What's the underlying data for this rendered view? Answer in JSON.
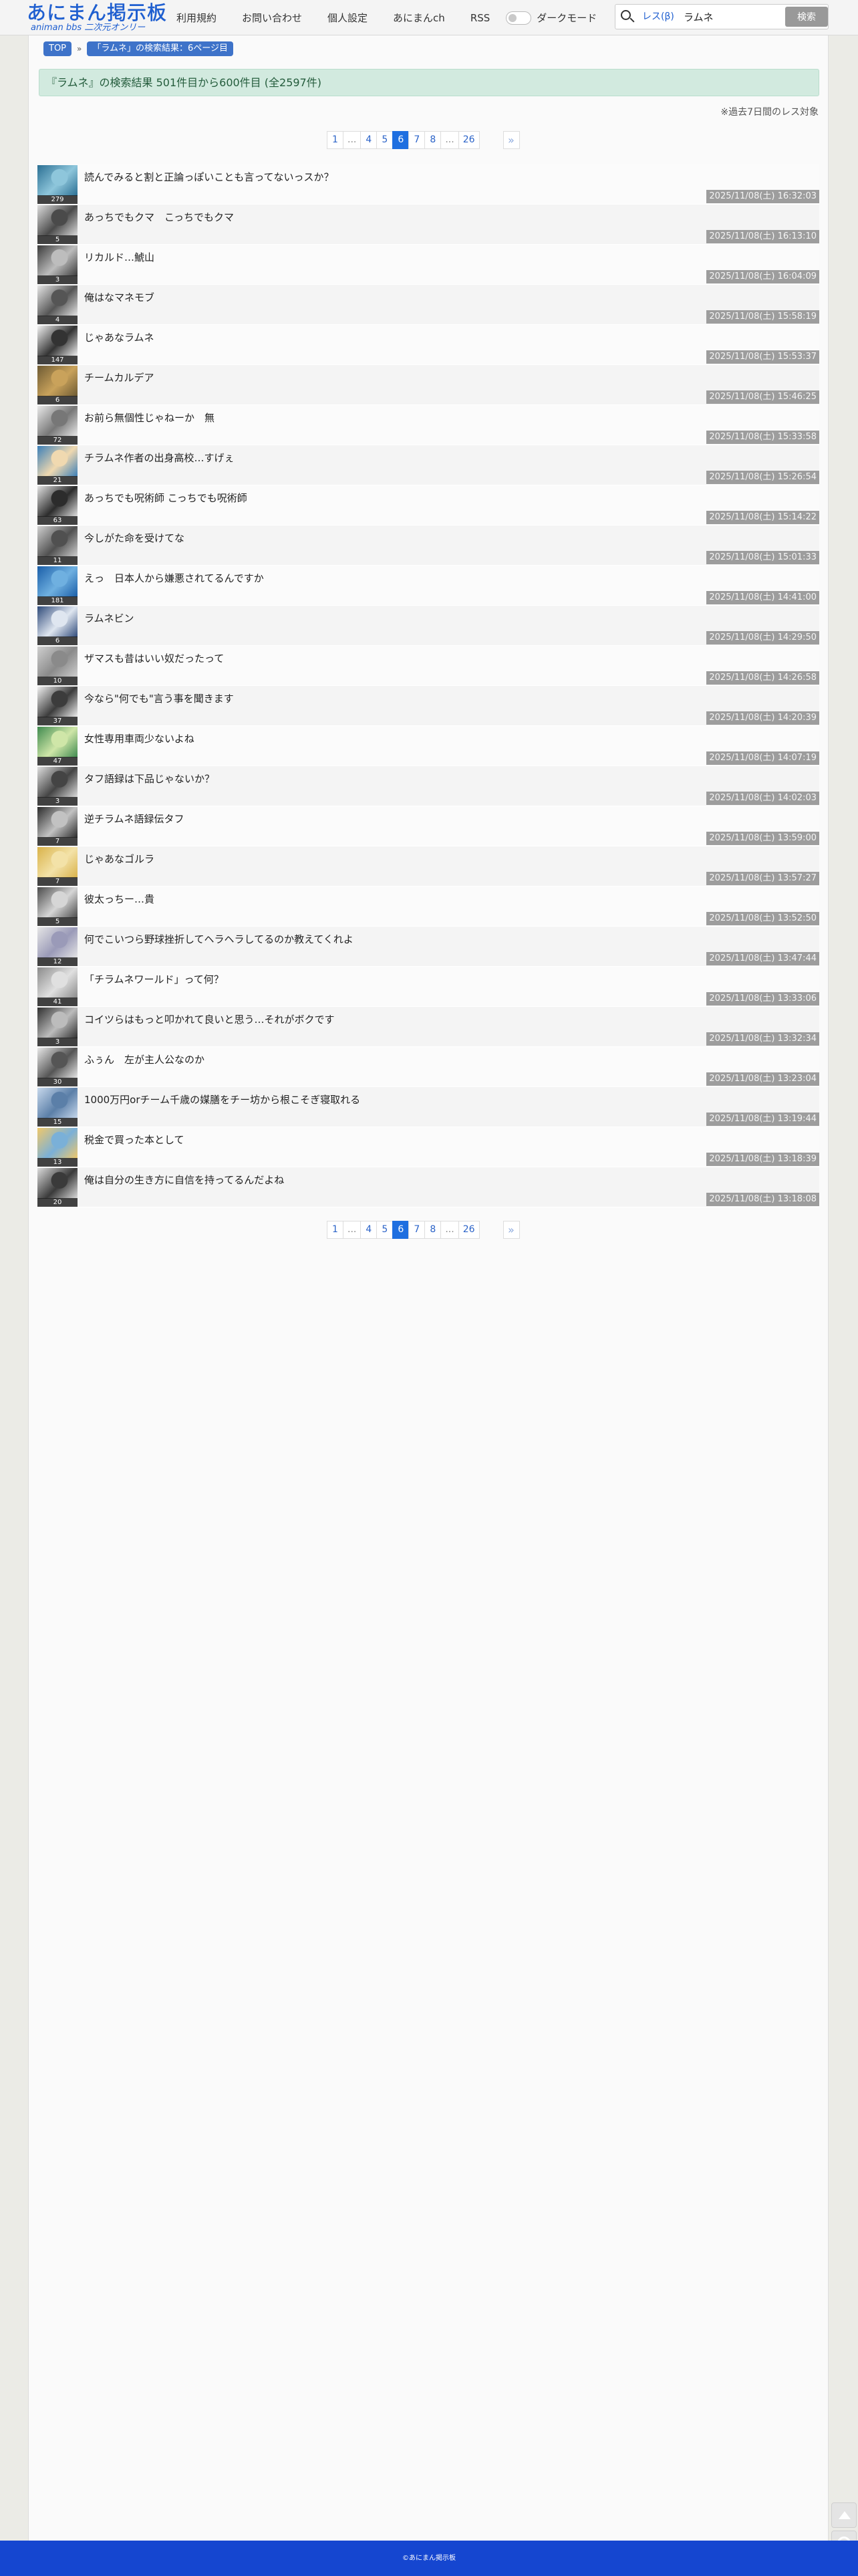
{
  "header": {
    "logo_main": "あにまん掲示板",
    "logo_sub": "animan bbs 二次元オンリー",
    "nav": [
      "利用規約",
      "お問い合わせ",
      "個人設定",
      "あにまんch",
      "RSS"
    ],
    "dark_mode_label": "ダークモード",
    "search_type": "レス(β)",
    "search_value": "ラムネ",
    "search_button": "検索"
  },
  "breadcrumb": [
    "TOP",
    "「ラムネ」の検索結果：6ページ目"
  ],
  "breadcrumb_sep": "»",
  "result_banner": "『ラムネ』の検索結果 501件目から600件目 (全2597件)",
  "note": "※過去7日間のレス対象",
  "pagination": [
    "«",
    "1",
    "...",
    "4",
    "5",
    "6",
    "7",
    "8",
    "...",
    "26",
    "»"
  ],
  "pagination_active": "6",
  "threads": [
    {
      "title": "読んでみると割と正論っぽいことも言ってないっスか？",
      "count": "279",
      "date": "2025/11/08(土) 16:32:03",
      "colors": [
        "#2b6f93",
        "#8ec6db"
      ]
    },
    {
      "title": "あっちでもクマ　こっちでもクマ",
      "count": "5",
      "date": "2025/11/08(土) 16:13:10",
      "colors": [
        "#dcdcdc",
        "#4a4a4a"
      ]
    },
    {
      "title": "リカルド…鯱山",
      "count": "3",
      "date": "2025/11/08(土) 16:04:09",
      "colors": [
        "#3a3a3a",
        "#bdbdbd"
      ]
    },
    {
      "title": "俺はなマネモブ",
      "count": "4",
      "date": "2025/11/08(土) 15:58:19",
      "colors": [
        "#e6e6e6",
        "#555555"
      ]
    },
    {
      "title": "じゃあなラムネ",
      "count": "147",
      "date": "2025/11/08(土) 15:53:37",
      "colors": [
        "#f2f2f2",
        "#333333"
      ]
    },
    {
      "title": "チームカルデア",
      "count": "6",
      "date": "2025/11/08(土) 15:46:25",
      "colors": [
        "#6d5a33",
        "#c9a25b"
      ]
    },
    {
      "title": "お前ら無個性じゃねーか　無",
      "count": "72",
      "date": "2025/11/08(土) 15:33:58",
      "colors": [
        "#e9e9e9",
        "#777777"
      ]
    },
    {
      "title": "チラムネ作者の出身高校…すげぇ",
      "count": "21",
      "date": "2025/11/08(土) 15:26:54",
      "colors": [
        "#3b7fb8",
        "#f0d9b0"
      ]
    },
    {
      "title": "あっちでも呪術師 こっちでも呪術師",
      "count": "63",
      "date": "2025/11/08(土) 15:14:22",
      "colors": [
        "#e2e2e2",
        "#2c2c2c"
      ]
    },
    {
      "title": "今しがた命を受けてな",
      "count": "11",
      "date": "2025/11/08(土) 15:01:33",
      "colors": [
        "#d0d0d0",
        "#505050"
      ]
    },
    {
      "title": "えっ　日本人から嫌悪されてるんですか",
      "count": "181",
      "date": "2025/11/08(土) 14:41:00",
      "colors": [
        "#1a5ea8",
        "#6fb0e0"
      ]
    },
    {
      "title": "ラムネビン",
      "count": "6",
      "date": "2025/11/08(土) 14:29:50",
      "colors": [
        "#2f4a7a",
        "#dfe6f0"
      ]
    },
    {
      "title": "ザマスも昔はいい奴だったって",
      "count": "10",
      "date": "2025/11/08(土) 14:26:58",
      "colors": [
        "#cfcfcf",
        "#8a8a8a"
      ]
    },
    {
      "title": "今なら\"何でも\"言う事を聞きます",
      "count": "37",
      "date": "2025/11/08(土) 14:20:39",
      "colors": [
        "#f0f0f0",
        "#3c3c3c"
      ]
    },
    {
      "title": "女性専用車両少ないよね",
      "count": "47",
      "date": "2025/11/08(土) 14:07:19",
      "colors": [
        "#3f8a4f",
        "#cfe6a8"
      ]
    },
    {
      "title": "タフ語録は下品じゃないか？",
      "count": "3",
      "date": "2025/11/08(土) 14:02:03",
      "colors": [
        "#dedede",
        "#444444"
      ]
    },
    {
      "title": "逆チラムネ語録伝タフ",
      "count": "7",
      "date": "2025/11/08(土) 13:59:00",
      "colors": [
        "#2a2a2a",
        "#c2c2c2"
      ]
    },
    {
      "title": "じゃあなゴルラ",
      "count": "7",
      "date": "2025/11/08(土) 13:57:27",
      "colors": [
        "#d9b24a",
        "#f3e2a8"
      ]
    },
    {
      "title": "彼太っちー…貴",
      "count": "5",
      "date": "2025/11/08(土) 13:52:50",
      "colors": [
        "#4a4a4a",
        "#d6d6d6"
      ]
    },
    {
      "title": "何でこいつら野球挫折してヘラヘラしてるのか教えてくれよ",
      "count": "12",
      "date": "2025/11/08(土) 13:47:44",
      "colors": [
        "#e5e5e5",
        "#9a9ab8"
      ]
    },
    {
      "title": "「チラムネワールド」って何？",
      "count": "41",
      "date": "2025/11/08(土) 13:33:06",
      "colors": [
        "#8b8b8b",
        "#e0e0e0"
      ]
    },
    {
      "title": "コイツらはもっと叩かれて良いと思う…それがボクです",
      "count": "3",
      "date": "2025/11/08(土) 13:32:34",
      "colors": [
        "#2f2f2f",
        "#bcbcbc"
      ]
    },
    {
      "title": "ふぅん　左が主人公なのか",
      "count": "30",
      "date": "2025/11/08(土) 13:23:04",
      "colors": [
        "#e8e8e8",
        "#555555"
      ]
    },
    {
      "title": "1000万円orチーム千歳の媒膳をチー坊から根こそぎ寝取れる",
      "count": "15",
      "date": "2025/11/08(土) 13:19:44",
      "colors": [
        "#c7d8ec",
        "#5b7fa8"
      ]
    },
    {
      "title": "税金で買った本として",
      "count": "13",
      "date": "2025/11/08(土) 13:18:39",
      "colors": [
        "#f0c86a",
        "#7ab0d8"
      ]
    },
    {
      "title": "俺は自分の生き方に自信を持ってるんだよね",
      "count": "20",
      "date": "2025/11/08(土) 13:18:08",
      "colors": [
        "#dcdcdc",
        "#3a3a3a"
      ]
    }
  ],
  "footer": "©あにまん掲示板"
}
